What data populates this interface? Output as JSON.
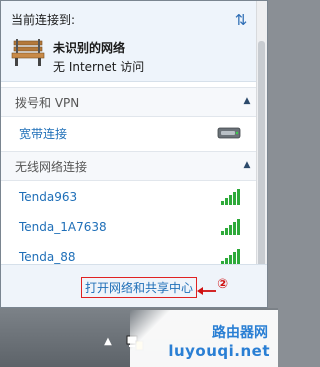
{
  "connected": {
    "title": "当前连接到:",
    "network_name": "未识别的网络",
    "network_status": "无 Internet 访问"
  },
  "sections": {
    "dialup": {
      "title": "拨号和 VPN",
      "items": [
        {
          "label": "宽带连接"
        }
      ]
    },
    "wireless": {
      "title": "无线网络连接",
      "items": [
        {
          "label": "Tenda963",
          "signal_bars": 5
        },
        {
          "label": "Tenda_1A7638",
          "signal_bars": 5
        },
        {
          "label": "Tenda_88",
          "signal_bars": 5
        }
      ]
    }
  },
  "footer": {
    "link_label": "打开网络和共享中心",
    "step": "②"
  },
  "watermark": {
    "line1": "路由器网",
    "line2": "luyouqi.net"
  },
  "colors": {
    "link": "#1f6fb8",
    "signal": "#2eaa3a",
    "highlight": "#e02222"
  }
}
